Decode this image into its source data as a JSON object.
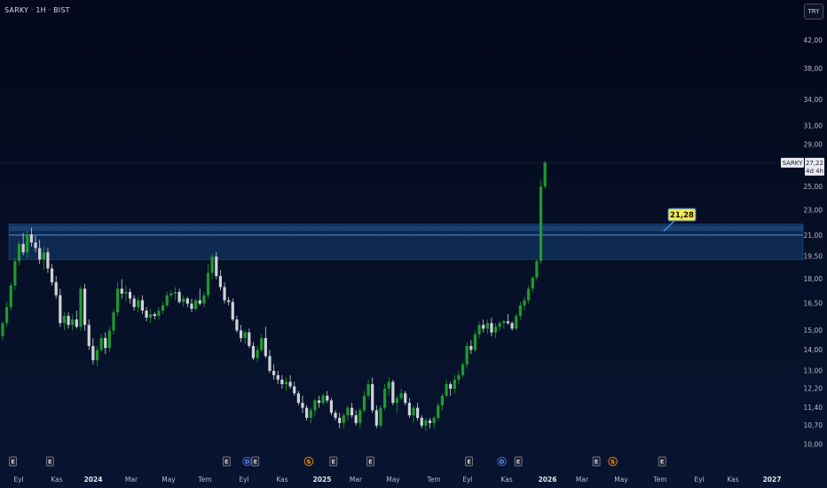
{
  "header": {
    "title": "SARKY · 1H · BIST"
  },
  "currency_button": "TRY",
  "price_label": {
    "symbol": "SARKY",
    "value": "27,22",
    "countdown": "4d 4h"
  },
  "callout": {
    "value": "21,28"
  },
  "colors": {
    "background": "#050a1e",
    "up": "#1f9b2c",
    "down": "#cfd2d8",
    "zone": "#1c4f8a",
    "callout_bg": "#f5e94a"
  },
  "chart_data": {
    "type": "candlestick",
    "title": "SARKY · 1H · BIST",
    "y_axis": {
      "scale": "log",
      "side": "right",
      "range": [
        9.85,
        48.5
      ],
      "ticks": [
        {
          "value": 42.0,
          "label": "42,00"
        },
        {
          "value": 38.0,
          "label": "38,00"
        },
        {
          "value": 34.0,
          "label": "34,00"
        },
        {
          "value": 31.0,
          "label": "31,00"
        },
        {
          "value": 29.0,
          "label": "29,00"
        },
        {
          "value": 25.0,
          "label": "25,00"
        },
        {
          "value": 23.0,
          "label": "23,00"
        },
        {
          "value": 21.0,
          "label": "21,00"
        },
        {
          "value": 19.5,
          "label": "19,50"
        },
        {
          "value": 18.0,
          "label": "18,00"
        },
        {
          "value": 16.5,
          "label": "16,50"
        },
        {
          "value": 15.0,
          "label": "15,00"
        },
        {
          "value": 14.0,
          "label": "14,00"
        },
        {
          "value": 13.0,
          "label": "13,00"
        },
        {
          "value": 12.2,
          "label": "12,20"
        },
        {
          "value": 11.4,
          "label": "11,40"
        },
        {
          "value": 10.7,
          "label": "10,70"
        },
        {
          "value": 10.0,
          "label": "10,00"
        }
      ]
    },
    "x_axis": {
      "ticks": [
        {
          "label": "Eyl",
          "year": false
        },
        {
          "label": "Kas",
          "year": false
        },
        {
          "label": "2024",
          "year": true
        },
        {
          "label": "Mar",
          "year": false
        },
        {
          "label": "May",
          "year": false
        },
        {
          "label": "Tem",
          "year": false
        },
        {
          "label": "Eyl",
          "year": false
        },
        {
          "label": "Kas",
          "year": false
        },
        {
          "label": "2025",
          "year": true
        },
        {
          "label": "Mar",
          "year": false
        },
        {
          "label": "May",
          "year": false
        },
        {
          "label": "Tem",
          "year": false
        },
        {
          "label": "Eyl",
          "year": false
        },
        {
          "label": "Kas",
          "year": false
        },
        {
          "label": "2026",
          "year": true
        },
        {
          "label": "Mar",
          "year": false
        },
        {
          "label": "May",
          "year": false
        },
        {
          "label": "Tem",
          "year": false
        },
        {
          "label": "Eyl",
          "year": false
        },
        {
          "label": "Kas",
          "year": false
        },
        {
          "label": "2027",
          "year": true
        }
      ]
    },
    "zone": {
      "low": 19.3,
      "high": 21.9,
      "mid": 21.05
    },
    "last_price": 27.22,
    "callout_price": 21.28,
    "events": [
      {
        "type": "E",
        "label": "E",
        "index": 1
      },
      {
        "type": "E",
        "label": "E",
        "index": 10
      },
      {
        "type": "E",
        "label": "E",
        "index": 53
      },
      {
        "type": "D",
        "label": "D",
        "index": 58
      },
      {
        "type": "E",
        "label": "E",
        "index": 60
      },
      {
        "type": "S",
        "label": "S",
        "index": 73
      },
      {
        "type": "E",
        "label": "E",
        "index": 79
      },
      {
        "type": "E",
        "label": "E",
        "index": 88
      },
      {
        "type": "E",
        "label": "E",
        "index": 112
      },
      {
        "type": "D",
        "label": "D",
        "index": 120
      },
      {
        "type": "E",
        "label": "E",
        "index": 124
      },
      {
        "type": "E",
        "label": "E",
        "index": 143
      },
      {
        "type": "S",
        "label": "S",
        "index": 147
      },
      {
        "type": "E",
        "label": "E",
        "index": 159
      }
    ],
    "candles": [
      [
        14.7,
        15.5,
        14.5,
        15.4
      ],
      [
        15.4,
        16.6,
        15.2,
        16.3
      ],
      [
        16.3,
        17.8,
        16.1,
        17.6
      ],
      [
        17.6,
        19.4,
        17.3,
        19.2
      ],
      [
        19.2,
        20.6,
        18.9,
        20.4
      ],
      [
        20.4,
        21.2,
        19.6,
        19.8
      ],
      [
        19.8,
        21.4,
        19.4,
        21.1
      ],
      [
        21.1,
        21.6,
        20.2,
        20.5
      ],
      [
        20.5,
        21.0,
        19.8,
        20.1
      ],
      [
        20.1,
        20.7,
        19.0,
        19.3
      ],
      [
        19.3,
        20.2,
        18.6,
        19.8
      ],
      [
        19.8,
        20.1,
        18.4,
        18.7
      ],
      [
        18.7,
        19.0,
        17.6,
        17.8
      ],
      [
        17.8,
        18.2,
        16.8,
        17.0
      ],
      [
        17.0,
        17.4,
        15.2,
        15.4
      ],
      [
        15.4,
        16.0,
        15.0,
        15.8
      ],
      [
        15.8,
        16.0,
        15.1,
        15.3
      ],
      [
        15.3,
        15.9,
        15.0,
        15.6
      ],
      [
        15.6,
        16.1,
        15.1,
        15.2
      ],
      [
        15.2,
        17.6,
        15.0,
        17.4
      ],
      [
        17.4,
        17.7,
        15.0,
        15.3
      ],
      [
        15.3,
        15.6,
        14.0,
        14.2
      ],
      [
        14.2,
        14.6,
        13.3,
        13.5
      ],
      [
        13.5,
        14.2,
        13.2,
        14.0
      ],
      [
        14.0,
        14.8,
        13.9,
        14.6
      ],
      [
        14.6,
        14.9,
        13.8,
        14.1
      ],
      [
        14.1,
        15.2,
        13.9,
        15.0
      ],
      [
        15.0,
        16.2,
        14.8,
        16.0
      ],
      [
        16.0,
        17.8,
        15.8,
        17.4
      ],
      [
        17.4,
        18.0,
        16.8,
        17.1
      ],
      [
        17.1,
        17.6,
        16.6,
        17.2
      ],
      [
        17.2,
        17.4,
        16.5,
        16.8
      ],
      [
        16.8,
        17.0,
        16.1,
        16.3
      ],
      [
        16.3,
        16.9,
        16.0,
        16.7
      ],
      [
        16.7,
        17.0,
        15.9,
        16.1
      ],
      [
        16.1,
        16.3,
        15.5,
        15.7
      ],
      [
        15.7,
        16.2,
        15.4,
        15.9
      ],
      [
        15.9,
        16.0,
        15.6,
        15.8
      ],
      [
        15.8,
        16.3,
        15.6,
        16.1
      ],
      [
        16.1,
        16.6,
        15.9,
        16.4
      ],
      [
        16.4,
        17.2,
        16.3,
        17.0
      ],
      [
        17.0,
        17.3,
        16.8,
        17.1
      ],
      [
        17.1,
        17.5,
        16.7,
        17.2
      ],
      [
        17.2,
        17.4,
        16.5,
        16.6
      ],
      [
        16.6,
        17.0,
        16.3,
        16.8
      ],
      [
        16.8,
        16.9,
        16.3,
        16.5
      ],
      [
        16.5,
        16.8,
        16.0,
        16.2
      ],
      [
        16.2,
        16.8,
        16.1,
        16.7
      ],
      [
        16.7,
        17.4,
        16.4,
        16.5
      ],
      [
        16.5,
        17.2,
        16.3,
        17.0
      ],
      [
        17.0,
        19.0,
        16.8,
        18.4
      ],
      [
        18.4,
        19.7,
        18.0,
        19.5
      ],
      [
        19.5,
        19.8,
        18.0,
        18.2
      ],
      [
        18.2,
        18.6,
        17.3,
        17.5
      ],
      [
        17.5,
        17.8,
        16.5,
        16.7
      ],
      [
        16.7,
        16.9,
        16.4,
        16.6
      ],
      [
        16.6,
        16.8,
        15.5,
        15.6
      ],
      [
        15.6,
        15.8,
        14.9,
        15.0
      ],
      [
        15.0,
        15.3,
        14.4,
        14.6
      ],
      [
        14.6,
        15.0,
        14.3,
        14.9
      ],
      [
        14.9,
        15.1,
        14.1,
        14.2
      ],
      [
        14.2,
        14.4,
        13.5,
        13.6
      ],
      [
        13.6,
        14.2,
        13.4,
        14.0
      ],
      [
        14.0,
        14.8,
        13.9,
        14.6
      ],
      [
        14.6,
        15.2,
        13.6,
        13.7
      ],
      [
        13.7,
        14.0,
        12.9,
        13.0
      ],
      [
        13.0,
        13.3,
        12.6,
        12.8
      ],
      [
        12.8,
        13.0,
        12.4,
        12.6
      ],
      [
        12.6,
        12.8,
        12.2,
        12.4
      ],
      [
        12.4,
        12.7,
        12.1,
        12.5
      ],
      [
        12.5,
        12.8,
        12.2,
        12.3
      ],
      [
        12.3,
        12.5,
        11.9,
        12.0
      ],
      [
        12.0,
        12.1,
        11.5,
        11.6
      ],
      [
        11.6,
        11.9,
        11.2,
        11.4
      ],
      [
        11.4,
        11.5,
        10.9,
        11.0
      ],
      [
        11.0,
        11.4,
        10.8,
        11.3
      ],
      [
        11.3,
        11.8,
        11.1,
        11.7
      ],
      [
        11.7,
        11.9,
        11.4,
        11.6
      ],
      [
        11.6,
        12.0,
        11.5,
        11.9
      ],
      [
        11.9,
        12.1,
        11.6,
        11.7
      ],
      [
        11.7,
        11.8,
        11.1,
        11.2
      ],
      [
        11.2,
        11.3,
        10.9,
        11.0
      ],
      [
        11.0,
        11.2,
        10.6,
        10.8
      ],
      [
        10.8,
        11.2,
        10.6,
        11.1
      ],
      [
        11.1,
        11.5,
        10.9,
        11.4
      ],
      [
        11.4,
        11.6,
        11.0,
        11.1
      ],
      [
        11.1,
        11.3,
        10.7,
        10.8
      ],
      [
        10.8,
        11.4,
        10.6,
        11.3
      ],
      [
        11.3,
        12.1,
        11.2,
        11.9
      ],
      [
        11.9,
        12.6,
        11.8,
        12.4
      ],
      [
        12.4,
        12.7,
        11.2,
        11.3
      ],
      [
        11.3,
        11.5,
        10.6,
        10.7
      ],
      [
        10.7,
        11.5,
        10.6,
        11.4
      ],
      [
        11.4,
        12.4,
        11.3,
        12.2
      ],
      [
        12.2,
        12.7,
        11.9,
        12.5
      ],
      [
        12.5,
        12.6,
        11.5,
        11.6
      ],
      [
        11.6,
        11.9,
        11.2,
        11.8
      ],
      [
        11.8,
        12.2,
        11.7,
        12.0
      ],
      [
        12.0,
        12.1,
        11.5,
        11.6
      ],
      [
        11.6,
        11.8,
        11.0,
        11.1
      ],
      [
        11.1,
        11.5,
        10.8,
        11.4
      ],
      [
        11.4,
        11.6,
        10.9,
        11.0
      ],
      [
        11.0,
        11.1,
        10.6,
        10.7
      ],
      [
        10.7,
        11.0,
        10.5,
        10.9
      ],
      [
        10.9,
        11.0,
        10.6,
        10.8
      ],
      [
        10.8,
        11.1,
        10.6,
        11.0
      ],
      [
        11.0,
        11.6,
        10.9,
        11.5
      ],
      [
        11.5,
        12.0,
        11.3,
        11.9
      ],
      [
        11.9,
        12.6,
        11.8,
        12.4
      ],
      [
        12.4,
        12.5,
        11.9,
        12.2
      ],
      [
        12.2,
        12.8,
        12.0,
        12.6
      ],
      [
        12.6,
        13.0,
        12.4,
        12.8
      ],
      [
        12.8,
        13.4,
        12.7,
        13.3
      ],
      [
        13.3,
        14.4,
        13.1,
        14.2
      ],
      [
        14.2,
        14.5,
        13.8,
        14.0
      ],
      [
        14.0,
        15.0,
        13.9,
        14.8
      ],
      [
        14.8,
        15.5,
        14.6,
        15.3
      ],
      [
        15.3,
        15.6,
        14.9,
        15.1
      ],
      [
        15.1,
        15.6,
        14.8,
        15.4
      ],
      [
        15.4,
        15.7,
        14.7,
        14.9
      ],
      [
        14.9,
        15.4,
        14.6,
        15.2
      ],
      [
        15.2,
        15.5,
        15.0,
        15.4
      ],
      [
        15.4,
        15.6,
        15.1,
        15.5
      ],
      [
        15.5,
        15.9,
        15.3,
        15.4
      ],
      [
        15.4,
        15.5,
        15.0,
        15.1
      ],
      [
        15.1,
        15.9,
        15.0,
        15.8
      ],
      [
        15.8,
        16.6,
        15.6,
        16.4
      ],
      [
        16.4,
        16.9,
        16.1,
        16.7
      ],
      [
        16.7,
        17.6,
        16.5,
        17.4
      ],
      [
        17.4,
        18.2,
        17.2,
        18.1
      ],
      [
        18.1,
        19.3,
        17.9,
        19.2
      ],
      [
        19.2,
        25.6,
        19.0,
        25.0
      ],
      [
        25.0,
        27.4,
        24.8,
        27.22
      ]
    ]
  }
}
